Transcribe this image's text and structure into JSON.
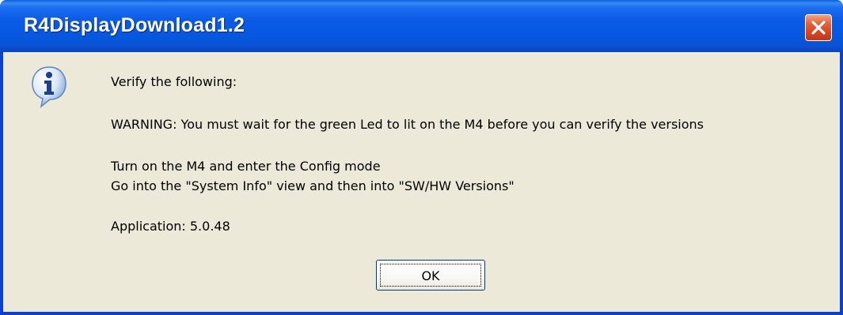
{
  "window": {
    "title": "R4DisplayDownload1.2"
  },
  "icon": "information-icon",
  "message": {
    "line1": "Verify the following:",
    "line2": "WARNING: You must wait for the green Led to lit on the M4 before you can verify the versions",
    "line3": "Turn on the M4 and enter the Config mode",
    "line4": "Go into the \"System Info\" view and then into \"SW/HW Versions\"",
    "line5": "Application: 5.0.48"
  },
  "buttons": {
    "ok_label": "OK"
  },
  "colors": {
    "titlebar": "#0a5ae6",
    "dialog_background": "#ece9d8",
    "close_button": "#d8441e"
  }
}
